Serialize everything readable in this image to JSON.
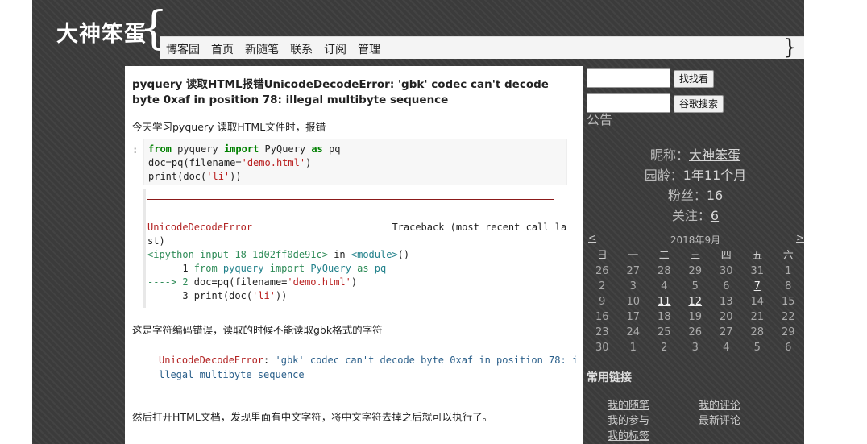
{
  "header": {
    "site_title": "大神笨蛋",
    "brace_open": "{",
    "brace_close": "}",
    "nav": [
      "博客园",
      "首页",
      "新随笔",
      "联系",
      "订阅",
      "管理"
    ]
  },
  "post": {
    "title": "pyquery 读取HTML报错UnicodeDecodeError: 'gbk' codec can't decode byte 0xaf in position 78: illegal multibyte sequence",
    "intro": "今天学习pyquery 读取HTML文件时，报错",
    "in_prompt": ":",
    "code": {
      "line1": {
        "kw1": "from",
        "mod": " pyquery ",
        "kw2": "import",
        "cls": " PyQuery ",
        "kw3": "as",
        "alias": " pq"
      },
      "line2": {
        "pre": "doc=pq(filename=",
        "str": "'demo.html'",
        "post": ")"
      },
      "line3": {
        "pre": "print(doc(",
        "str": "'li'",
        "post": "))"
      }
    },
    "traceback": {
      "err_name": "UnicodeDecodeError",
      "trace_head": "Traceback (most recent call la",
      "trace_tail": "st)",
      "input_ref": "<ipython-input-18-1d02ff0de91c>",
      "in_word": " in ",
      "module_ref": "<module>",
      "module_tail": "()",
      "tb1_num": "      1 ",
      "tb1_from": "from",
      "tb1_mod": " pyquery ",
      "tb1_import": "import",
      "tb1_cls": " PyQuery ",
      "tb1_as": "as",
      "tb1_alias": " pq",
      "tb2_arrow": "----> 2 ",
      "tb2_pre": "doc=pq(filename=",
      "tb2_str": "'demo.html'",
      "tb2_post": ")",
      "tb3_num": "      3 ",
      "tb3_pre": "print(doc(",
      "tb3_str": "'li'",
      "tb3_post": "))"
    },
    "explain": "这是字符编码错误，读取的时候不能读取gbk格式的字符",
    "error_msg": {
      "name": "UnicodeDecodeError",
      "colon": ": ",
      "msg1": "'gbk' codec can't decode byte 0xaf in position 78: i",
      "msg2": "llegal multibyte sequence"
    },
    "conclusion": "然后打开HTML文档，发现里面有中文字符，将中文字符去掉之后就可以执行了。"
  },
  "sidebar": {
    "search_button": "找找看",
    "google_button": "谷歌搜索",
    "notice_heading": "公告",
    "profile": {
      "nickname_label": "昵称：",
      "nickname": "大神笨蛋",
      "age_label": "园龄：",
      "age": "1年11个月",
      "fans_label": "粉丝：",
      "fans": "16",
      "follow_label": "关注：",
      "follow": "6"
    },
    "calendar": {
      "prev": "<",
      "next": ">",
      "title": "2018年9月",
      "weekdays": [
        "日",
        "一",
        "二",
        "三",
        "四",
        "五",
        "六"
      ],
      "weeks": [
        [
          "26",
          "27",
          "28",
          "29",
          "30",
          "31",
          "1"
        ],
        [
          "2",
          "3",
          "4",
          "5",
          "6",
          "7",
          "8"
        ],
        [
          "9",
          "10",
          "11",
          "12",
          "13",
          "14",
          "15"
        ],
        [
          "16",
          "17",
          "18",
          "19",
          "20",
          "21",
          "22"
        ],
        [
          "23",
          "24",
          "25",
          "26",
          "27",
          "28",
          "29"
        ],
        [
          "30",
          "1",
          "2",
          "3",
          "4",
          "5",
          "6"
        ]
      ],
      "linked_days": [
        "7",
        "11",
        "12"
      ]
    },
    "links_heading": "常用链接",
    "links": [
      "我的随笔",
      "我的评论",
      "我的参与",
      "最新评论",
      "我的标签"
    ]
  }
}
